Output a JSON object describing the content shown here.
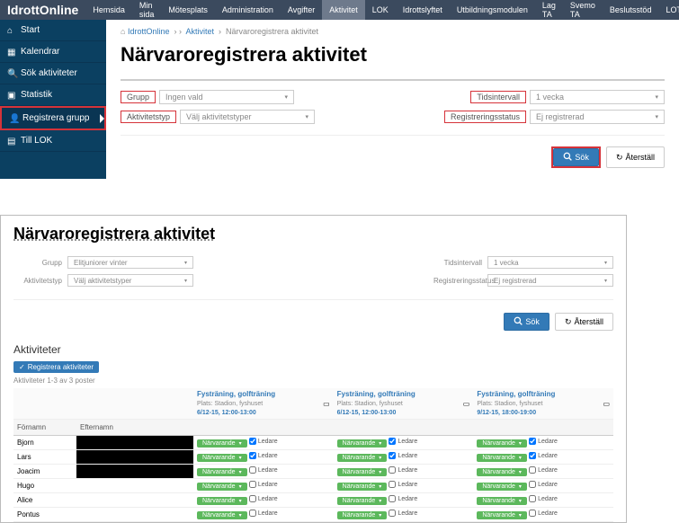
{
  "brand": "IdrottOnline",
  "topnav": [
    "Hemsida",
    "Min sida",
    "Mötesplats",
    "Administration",
    "Avgifter",
    "Aktivitet",
    "LOK",
    "Idrottslyftet",
    "Utbildningsmodulen",
    "Lag TA",
    "Svemo TA",
    "Beslutsstöd",
    "LOTS"
  ],
  "topnav_active": 5,
  "sidebar": [
    {
      "label": "Start"
    },
    {
      "label": "Kalendrar"
    },
    {
      "label": "Sök aktiviteter"
    },
    {
      "label": "Statistik"
    },
    {
      "label": "Registrera grupp",
      "active": true
    },
    {
      "label": "Till LOK"
    }
  ],
  "breadcrumb": {
    "home": "IdrottOnline",
    "section": "Aktivitet",
    "page": "Närvaroregistrera aktivitet"
  },
  "title": "Närvaroregistrera aktivitet",
  "form": {
    "grupp_label": "Grupp",
    "grupp_value": "Ingen vald",
    "tidsintervall_label": "Tidsintervall",
    "tidsintervall_value": "1 vecka",
    "aktivitetstyp_label": "Aktivitetstyp",
    "aktivitetstyp_placeholder": "Välj aktivitetstyper",
    "registreringsstatus_label": "Registreringsstatus",
    "registreringsstatus_value": "Ej registrerad",
    "sok": "Sök",
    "aterstall": "Återställ"
  },
  "panel2": {
    "title": "Närvaroregistrera aktivitet",
    "grupp_label": "Grupp",
    "grupp_value": "Elitjuniorer vinter",
    "tidsintervall_label": "Tidsintervall",
    "tidsintervall_value": "1 vecka",
    "aktivitetstyp_label": "Aktivitetstyp",
    "aktivitetstyp_placeholder": "Välj aktivitetstyper",
    "registreringsstatus_label": "Registreringsstatus",
    "registreringsstatus_value": "Ej registrerad",
    "sok": "Sök",
    "aterstall": "Återställ",
    "sub": "Aktiviteter",
    "reg_btn": "Registrera aktiviteter",
    "count": "Aktiviteter 1-3 av 3 poster",
    "col_fornamn": "Förnamn",
    "col_efternamn": "Efternamn",
    "sessions": [
      {
        "title": "Fysträning, golfträning",
        "plats": "Plats: Stadion, fyshuset",
        "time": "6/12-15, 12:00-13:00"
      },
      {
        "title": "Fysträning, golfträning",
        "plats": "Plats: Stadion, fyshuset",
        "time": "6/12-15, 12:00-13:00"
      },
      {
        "title": "Fysträning, golfträning",
        "plats": "Plats: Stadion, fyshuset",
        "time": "9/12-15, 18:00-19:00"
      }
    ],
    "people": [
      "Bjorn",
      "Lars",
      "Joacim",
      "Hugo",
      "Alice",
      "Pontus"
    ],
    "ledare_flags": [
      [
        true,
        true,
        true
      ],
      [
        true,
        true,
        true
      ],
      [
        false,
        false,
        false
      ],
      [
        false,
        false,
        false
      ],
      [
        false,
        false,
        false
      ],
      [
        false,
        false,
        false
      ]
    ],
    "att_label": "Närvarande",
    "ledare_label": "Ledare"
  }
}
